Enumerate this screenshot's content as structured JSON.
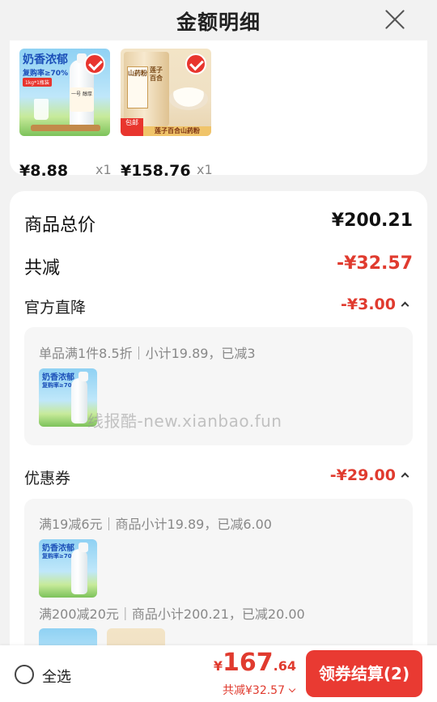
{
  "header": {
    "title": "金额明细"
  },
  "products": [
    {
      "price": "¥8.88",
      "qty": "x1",
      "art": {
        "headline": "奶香浓郁",
        "sub": "复购率≥70%",
        "tag": "1kg*1瓶装",
        "label": "一号 醇厚"
      }
    },
    {
      "price": "¥158.76",
      "qty": "x1",
      "art": {
        "can_left": "山药粉",
        "can_right": "莲子百合",
        "badge": "包邮",
        "strip": "莲子百合山药粉"
      }
    }
  ],
  "summary": {
    "total_label": "商品总价",
    "total_value": "¥200.21",
    "reduce_label": "共减",
    "reduce_value": "-¥32.57",
    "official": {
      "label": "官方直降",
      "value": "-¥3.00",
      "detail": "单品满1件8.5折｜小计19.89，已减3"
    },
    "coupon": {
      "label": "优惠券",
      "value": "-¥29.00",
      "detail1": "满19减6元｜商品小计19.89，已减6.00",
      "detail2": "满200减20元｜商品小计200.21，已减20.00"
    }
  },
  "watermark": "线报酷-new.xianbao.fun",
  "bottom_bar": {
    "select_all": "全选",
    "currency": "¥",
    "total_int": "167",
    "total_dec": ".64",
    "discount": "共减¥32.57",
    "checkout": "领券结算(2)"
  },
  "colors": {
    "accent": "#e93a32",
    "discount_red": "#e03b2f"
  }
}
